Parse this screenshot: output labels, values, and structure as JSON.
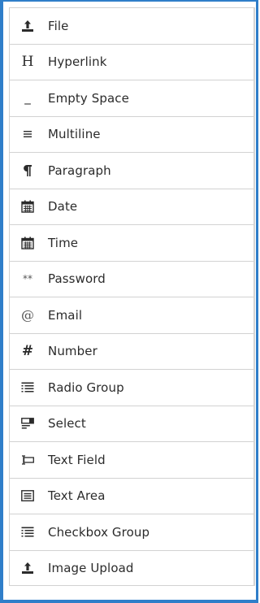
{
  "toolbox": {
    "accent_color": "#2f7ec9",
    "items": [
      {
        "label": "File",
        "icon": "upload-icon"
      },
      {
        "label": "Hyperlink",
        "icon": "heading-icon"
      },
      {
        "label": "Empty Space",
        "icon": "underscore-icon"
      },
      {
        "label": "Multiline",
        "icon": "lines-icon"
      },
      {
        "label": "Paragraph",
        "icon": "pilcrow-icon"
      },
      {
        "label": "Date",
        "icon": "calendar-icon"
      },
      {
        "label": "Time",
        "icon": "calendar-icon"
      },
      {
        "label": "Password",
        "icon": "asterisks-icon"
      },
      {
        "label": "Email",
        "icon": "at-sign-icon"
      },
      {
        "label": "Number",
        "icon": "hash-icon"
      },
      {
        "label": "Radio Group",
        "icon": "radio-list-icon"
      },
      {
        "label": "Select",
        "icon": "select-icon"
      },
      {
        "label": "Text Field",
        "icon": "text-field-icon"
      },
      {
        "label": "Text Area",
        "icon": "text-area-icon"
      },
      {
        "label": "Checkbox Group",
        "icon": "checkbox-list-icon"
      },
      {
        "label": "Image Upload",
        "icon": "upload-icon"
      }
    ],
    "glyphs": {
      "heading": "H",
      "underscore": "_",
      "asterisks": "**",
      "at": "@",
      "hash": "#"
    }
  }
}
